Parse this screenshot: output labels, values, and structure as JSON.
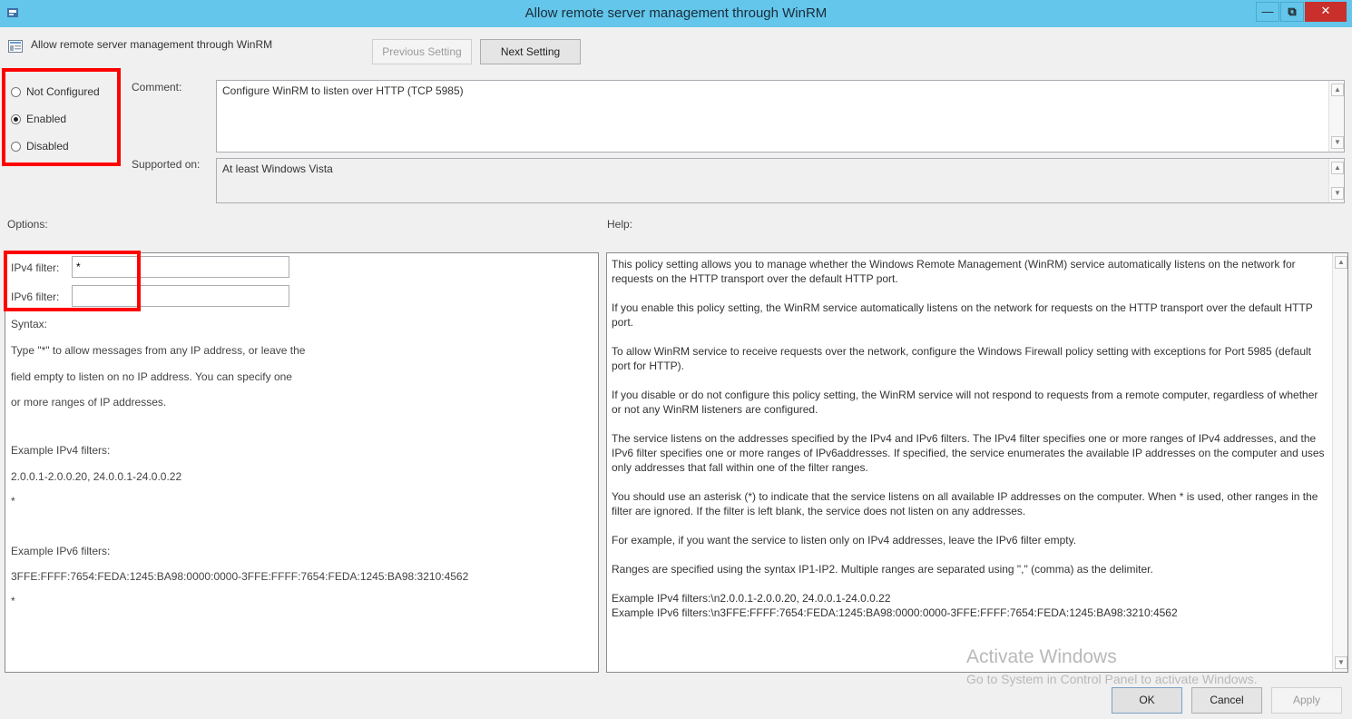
{
  "window": {
    "title": "Allow remote server management through WinRM",
    "minimize_glyph": "—",
    "maximize_glyph": "⧉",
    "close_glyph": "✕"
  },
  "header": {
    "policy_name": "Allow remote server management through WinRM",
    "previous_label": "Previous Setting",
    "next_label": "Next Setting"
  },
  "state": {
    "options": [
      {
        "label": "Not Configured",
        "selected": false
      },
      {
        "label": "Enabled",
        "selected": true
      },
      {
        "label": "Disabled",
        "selected": false
      }
    ]
  },
  "comment": {
    "label": "Comment:",
    "value": "Configure WinRM to listen over HTTP (TCP 5985)"
  },
  "supported": {
    "label": "Supported on:",
    "value": "At least Windows Vista"
  },
  "options_section": {
    "label": "Options:",
    "ipv4_label": "IPv4 filter:",
    "ipv4_value": "*",
    "ipv6_label": "IPv6 filter:",
    "ipv6_value": "",
    "syntax_label": "Syntax:",
    "lines": [
      "Type \"*\" to allow messages from any IP address, or leave the",
      "field empty to listen on no IP address. You can specify one",
      "or more ranges of IP addresses."
    ],
    "example_ipv4_label": "Example IPv4 filters:",
    "example_ipv4_value": "2.0.0.1-2.0.0.20, 24.0.0.1-24.0.0.22",
    "example_ipv4_star": "*",
    "example_ipv6_label": "Example IPv6 filters:",
    "example_ipv6_value": "3FFE:FFFF:7654:FEDA:1245:BA98:0000:0000-3FFE:FFFF:7654:FEDA:1245:BA98:3210:4562",
    "example_ipv6_star": "*"
  },
  "help_section": {
    "label": "Help:",
    "paragraphs": [
      "This policy setting allows you to manage whether the Windows Remote Management (WinRM) service automatically listens on the network for requests on the HTTP transport over the default HTTP port.",
      "If you enable this policy setting, the WinRM service automatically listens on the network for requests on the HTTP transport over the default HTTP port.",
      "To allow WinRM service to receive requests over the network, configure the Windows Firewall policy setting with exceptions for Port 5985 (default port for HTTP).",
      "If you disable or do not configure this policy setting, the WinRM service will not respond to requests from a remote computer, regardless of whether or not any WinRM listeners are configured.",
      "The service listens on the addresses specified by the IPv4 and IPv6 filters. The IPv4 filter specifies one or more ranges of IPv4 addresses, and the IPv6 filter specifies one or more ranges of IPv6addresses. If specified, the service enumerates the available IP addresses on the computer and uses only addresses that fall within one of the filter ranges.",
      "You should use an asterisk (*) to indicate that the service listens on all available IP addresses on the computer. When * is used, other ranges in the filter are ignored. If the filter is left blank, the service does not listen on any addresses.",
      "For example, if you want the service to listen only on IPv4 addresses, leave the IPv6 filter empty.",
      "Ranges are specified using the syntax IP1-IP2. Multiple ranges are separated using \",\" (comma) as the delimiter.",
      "Example IPv4 filters:\\n2.0.0.1-2.0.0.20, 24.0.0.1-24.0.0.22\nExample IPv6 filters:\\n3FFE:FFFF:7654:FEDA:1245:BA98:0000:0000-3FFE:FFFF:7654:FEDA:1245:BA98:3210:4562"
    ]
  },
  "watermark": {
    "line1": "Activate Windows",
    "line2": "Go to System in Control Panel to activate Windows."
  },
  "footer": {
    "ok_label": "OK",
    "cancel_label": "Cancel",
    "apply_label": "Apply"
  },
  "colors": {
    "titlebar": "#63c6ea",
    "highlight": "#ff0000",
    "close": "#c9302c"
  }
}
